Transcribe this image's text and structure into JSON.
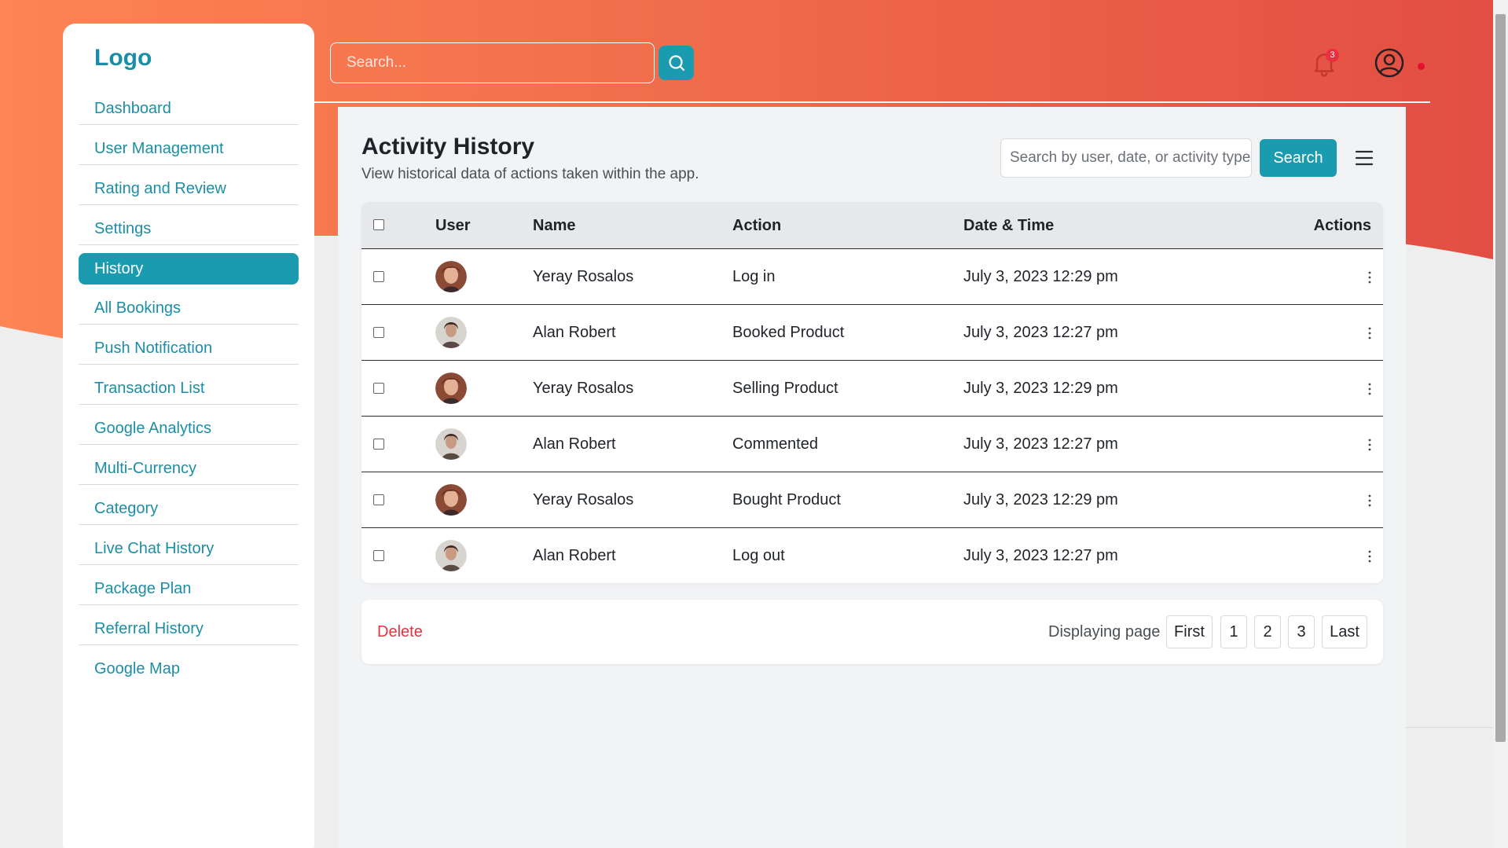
{
  "brand": {
    "logo": "Logo",
    "accent": "#1b9bb0",
    "danger": "#e8303f",
    "gradient_start": "#fd8454",
    "gradient_end": "#e24e43"
  },
  "topbar": {
    "search_placeholder": "Search...",
    "notification_count": "3"
  },
  "sidebar": {
    "items": [
      {
        "label": "Dashboard"
      },
      {
        "label": "User Management"
      },
      {
        "label": "Rating and Review"
      },
      {
        "label": "Settings"
      },
      {
        "label": "History",
        "active": true
      },
      {
        "label": "All Bookings"
      },
      {
        "label": "Push Notification"
      },
      {
        "label": "Transaction List"
      },
      {
        "label": "Google Analytics"
      },
      {
        "label": "Multi-Currency"
      },
      {
        "label": "Category"
      },
      {
        "label": "Live Chat History"
      },
      {
        "label": "Package Plan"
      },
      {
        "label": "Referral History"
      },
      {
        "label": "Google Map"
      }
    ]
  },
  "main": {
    "title": "Activity History",
    "subtitle": "View historical data of actions taken within the app.",
    "filter_placeholder": "Search by user, date, or activity type",
    "filter_button": "Search"
  },
  "table": {
    "headers": {
      "user": "User",
      "name": "Name",
      "action": "Action",
      "datetime": "Date & Time",
      "actions": "Actions"
    },
    "rows": [
      {
        "name": "Yeray Rosalos",
        "action": "Log in",
        "datetime": "July 3, 2023 12:29 pm",
        "avatar": "female"
      },
      {
        "name": "Alan Robert",
        "action": "Booked Product",
        "datetime": "July 3, 2023 12:27 pm",
        "avatar": "male"
      },
      {
        "name": "Yeray Rosalos",
        "action": "Selling Product",
        "datetime": "July 3, 2023 12:29 pm",
        "avatar": "female"
      },
      {
        "name": "Alan Robert",
        "action": "Commented",
        "datetime": "July 3, 2023 12:27 pm",
        "avatar": "male"
      },
      {
        "name": "Yeray Rosalos",
        "action": "Bought Product",
        "datetime": "July 3, 2023 12:29 pm",
        "avatar": "female"
      },
      {
        "name": "Alan Robert",
        "action": "Log out",
        "datetime": "July 3, 2023 12:27 pm",
        "avatar": "male"
      }
    ]
  },
  "footer": {
    "delete_label": "Delete",
    "paging_label": "Displaying page",
    "pages": [
      "First",
      "1",
      "2",
      "3",
      "Last"
    ]
  }
}
